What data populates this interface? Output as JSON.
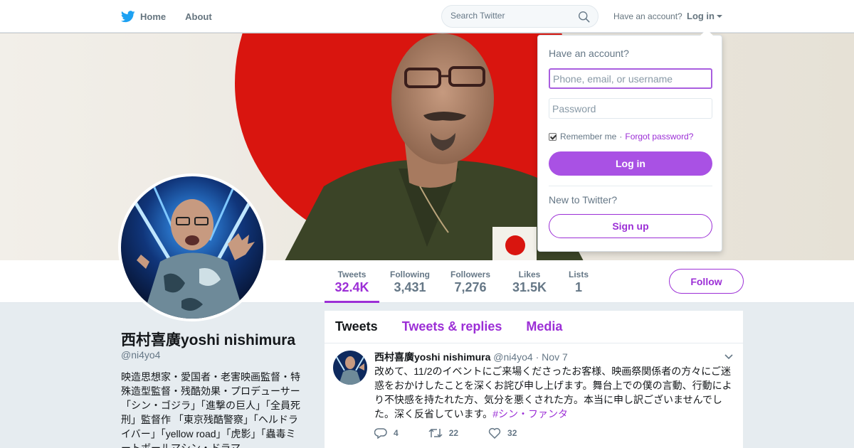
{
  "brand": {
    "accent": "#9c2fd6",
    "twitter_blue": "#1da1f2",
    "icon": "twitter-bird-icon"
  },
  "nav": {
    "home": "Home",
    "about": "About",
    "search_placeholder": "Search Twitter",
    "have_account": "Have an account?",
    "login": "Log in"
  },
  "profile": {
    "name": "西村喜廣yoshi nishimura",
    "handle": "@ni4yo4",
    "bio": "映造思想家・愛国者・老害映画監督・特殊造型監督・残酷効果・プロデューサー「シン・ゴジラ」「進撃の巨人」「全員死刑」監督作 「東京残酷警察」「ヘルドライバー」「yellow road」「虎影」「蟲毒ミートボールマシン・ドラマ",
    "stats": [
      {
        "label": "Tweets",
        "value": "32.4K",
        "active": true
      },
      {
        "label": "Following",
        "value": "3,431"
      },
      {
        "label": "Followers",
        "value": "7,276"
      },
      {
        "label": "Likes",
        "value": "31.5K"
      },
      {
        "label": "Lists",
        "value": "1"
      }
    ],
    "follow": "Follow"
  },
  "timeline": {
    "tabs": [
      "Tweets",
      "Tweets & replies",
      "Media"
    ],
    "tweet": {
      "name": "西村喜廣yoshi nishimura",
      "handle": "@ni4yo4",
      "sep": "·",
      "date": "Nov 7",
      "text": "改めて、11/2のイベントにご来場くださったお客様、映画祭関係者の方々にご迷惑をおかけしたことを深くお詫び申し上げます。舞台上での僕の言動、行動により不快感を持たれた方、気分を悪くされた方。本当に申し訳ございませんでした。深く反省しています。",
      "hashtag": "#シン・ファンタ",
      "replies": "4",
      "retweets": "22",
      "likes": "32"
    }
  },
  "login_dropdown": {
    "title": "Have an account?",
    "username_placeholder": "Phone, email, or username",
    "password_placeholder": "Password",
    "remember": "Remember me",
    "sep": "·",
    "forgot": "Forgot password?",
    "login_button": "Log in",
    "new_to": "New to Twitter?",
    "signup_button": "Sign up"
  }
}
